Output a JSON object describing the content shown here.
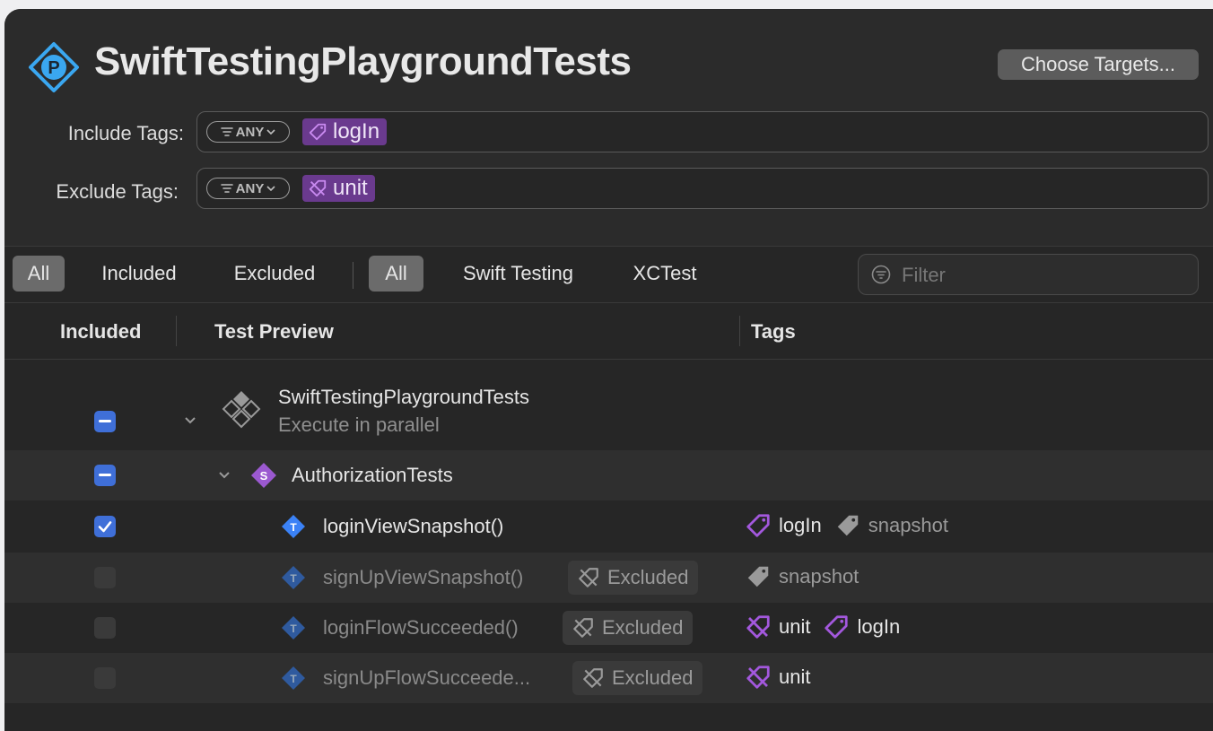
{
  "header": {
    "title": "SwiftTestingPlaygroundTests",
    "choose_targets": "Choose Targets..."
  },
  "include": {
    "label": "Include Tags:",
    "match": "ANY",
    "tag": "logIn"
  },
  "exclude": {
    "label": "Exclude Tags:",
    "match": "ANY",
    "tag": "unit"
  },
  "toolbar": {
    "scope": [
      "All",
      "Included",
      "Excluded"
    ],
    "framework": [
      "All",
      "Swift Testing",
      "XCTest"
    ],
    "filter_placeholder": "Filter"
  },
  "columns": {
    "included": "Included",
    "preview": "Test Preview",
    "tags": "Tags"
  },
  "tree": {
    "target": {
      "name": "SwiftTestingPlaygroundTests",
      "subtitle": "Execute in parallel"
    },
    "suite": {
      "name": "AuthorizationTests",
      "badge": "S"
    },
    "test_badge": "T",
    "tests": [
      {
        "name": "loginViewSnapshot()",
        "included": true,
        "excluded_label": "",
        "tags": [
          "logIn",
          "snapshot"
        ]
      },
      {
        "name": "signUpViewSnapshot()",
        "included": false,
        "excluded_label": "Excluded",
        "tags": [
          "snapshot"
        ]
      },
      {
        "name": "loginFlowSucceeded()",
        "included": false,
        "excluded_label": "Excluded",
        "tags": [
          "unit",
          "logIn"
        ]
      },
      {
        "name": "signUpFlowSucceede...",
        "included": false,
        "excluded_label": "Excluded",
        "tags": [
          "unit"
        ]
      }
    ]
  },
  "colors": {
    "accent": "#3f6fd8",
    "tag_purple": "#a358dd",
    "token_bg": "#6a3a8e",
    "test_blue": "#3b82f6"
  }
}
